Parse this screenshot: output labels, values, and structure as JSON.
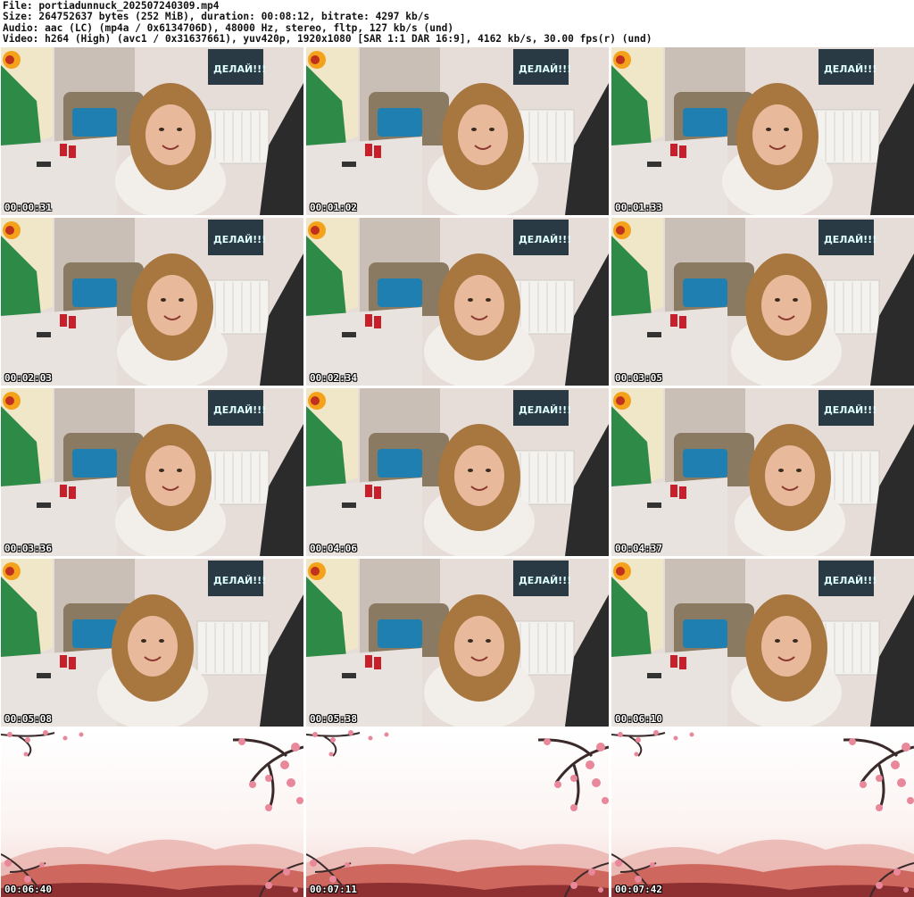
{
  "header": {
    "file": "File: portiadunnuck_202507240309.mp4",
    "size": "Size: 264752637 bytes (252 MiB), duration: 00:08:12, bitrate: 4297 kb/s",
    "audio": "Audio: aac (LC) (mp4a / 0x6134706D), 48000 Hz, stereo, fltp, 127 kb/s (und)",
    "video": "Video: h264 (High) (avc1 / 0x31637661), yuv420p, 1920x1080 [SAR 1:1 DAR 16:9], 4162 kb/s, 30.00 fps(r) (und)"
  },
  "poster_text": "ДЕЛАЙ!!!",
  "colors": {
    "wall": "#e6ddd8",
    "radiator": "#f4f2ef",
    "blanket_green": "#2e8a47",
    "pillow": "#1f7fb0",
    "table": "#e9e3df",
    "hair": "#a8763f",
    "shirt": "#f2efea",
    "skin": "#e9b99c",
    "cans": "#c8202a",
    "blossom_pink": "#e8889a",
    "blossom_branch": "#3a2a2a",
    "mountains": "#c9584f"
  },
  "thumbnails": [
    {
      "time": "00:00:31",
      "scene": "room"
    },
    {
      "time": "00:01:02",
      "scene": "room"
    },
    {
      "time": "00:01:33",
      "scene": "room"
    },
    {
      "time": "00:02:03",
      "scene": "room"
    },
    {
      "time": "00:02:34",
      "scene": "room"
    },
    {
      "time": "00:03:05",
      "scene": "room"
    },
    {
      "time": "00:03:36",
      "scene": "room"
    },
    {
      "time": "00:04:06",
      "scene": "room"
    },
    {
      "time": "00:04:37",
      "scene": "room"
    },
    {
      "time": "00:05:08",
      "scene": "room"
    },
    {
      "time": "00:05:38",
      "scene": "room"
    },
    {
      "time": "00:06:10",
      "scene": "room"
    },
    {
      "time": "00:06:40",
      "scene": "blossom"
    },
    {
      "time": "00:07:11",
      "scene": "blossom"
    },
    {
      "time": "00:07:42",
      "scene": "blossom"
    }
  ]
}
